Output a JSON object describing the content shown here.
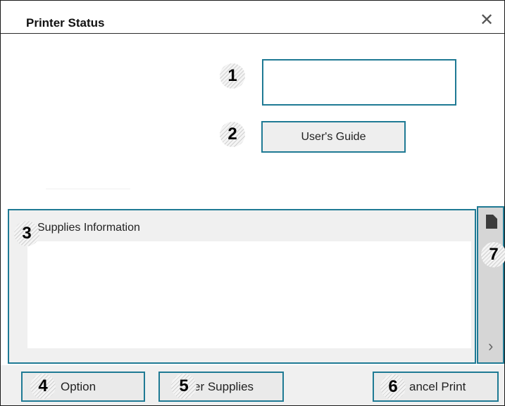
{
  "window": {
    "title": "Printer Status",
    "close_icon": "close-icon"
  },
  "top": {
    "users_guide_label": "User's Guide",
    "status_value": ""
  },
  "supplies": {
    "label": "Supplies Information"
  },
  "side": {
    "doc_icon": "document-icon",
    "chevron_icon": "chevron-right-icon",
    "chevron_glyph": "›"
  },
  "bottom": {
    "option_label": "Option",
    "order_label": "er Supplies",
    "cancel_label": "ancel Print"
  },
  "callouts": [
    "1",
    "2",
    "3",
    "4",
    "5",
    "6",
    "7"
  ],
  "colors": {
    "accent": "#1f7a94",
    "panel_bg": "#f0f0f0",
    "strip_bg": "#d6d6d6"
  }
}
